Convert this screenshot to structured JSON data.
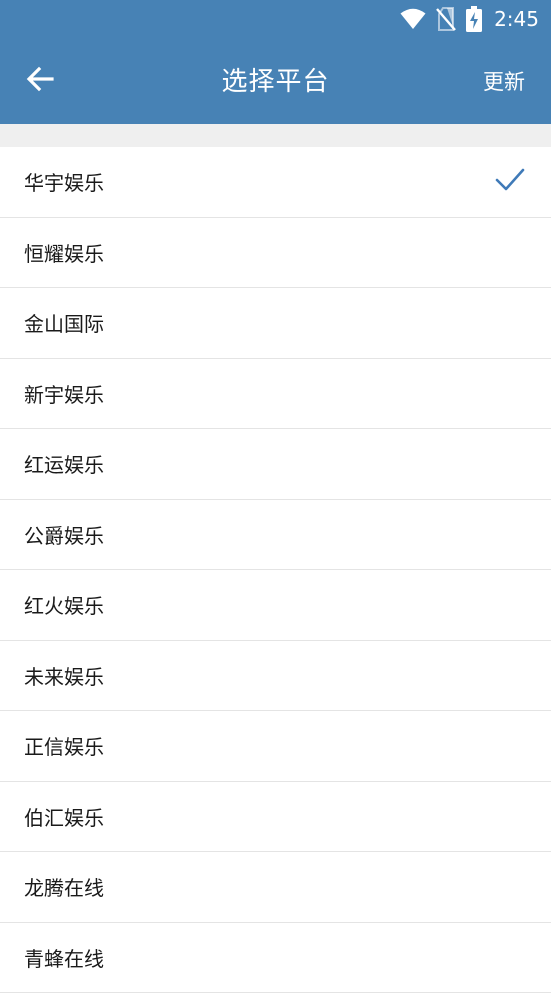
{
  "status": {
    "time": "2:45"
  },
  "header": {
    "title": "选择平台",
    "refresh_label": "更新"
  },
  "platforms": [
    {
      "label": "华宇娱乐",
      "selected": true
    },
    {
      "label": "恒耀娱乐",
      "selected": false
    },
    {
      "label": "金山国际",
      "selected": false
    },
    {
      "label": "新宇娱乐",
      "selected": false
    },
    {
      "label": "红运娱乐",
      "selected": false
    },
    {
      "label": "公爵娱乐",
      "selected": false
    },
    {
      "label": "红火娱乐",
      "selected": false
    },
    {
      "label": "未来娱乐",
      "selected": false
    },
    {
      "label": "正信娱乐",
      "selected": false
    },
    {
      "label": "伯汇娱乐",
      "selected": false
    },
    {
      "label": "龙腾在线",
      "selected": false
    },
    {
      "label": "青蜂在线",
      "selected": false
    }
  ],
  "colors": {
    "appbar": "#4782b5",
    "check": "#3f7ab8",
    "divider": "#e4e4e4",
    "gap": "#efefef"
  },
  "icons": {
    "back": "arrow-back-icon",
    "check": "checkmark-icon",
    "wifi": "wifi-icon",
    "no_sim": "no-sim-icon",
    "battery": "battery-charging-icon"
  }
}
